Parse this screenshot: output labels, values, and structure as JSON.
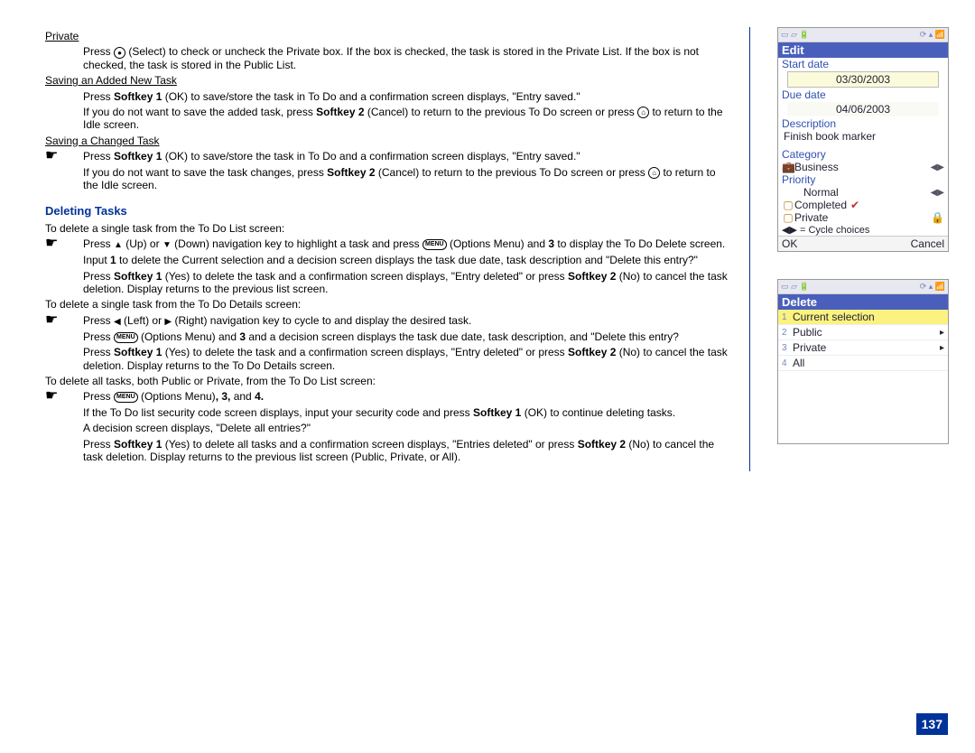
{
  "sections": {
    "private_hdr": "Private",
    "private_p1_a": "Press ",
    "private_p1_b": " (Select) to check or uncheck the Private box. If the box is checked, the task is stored in the Private List. If the box is not checked, the task is stored in the Public List.",
    "saving_add_hdr": "Saving an Added New Task",
    "saving_add_p1_a": "Press ",
    "saving_add_p1_b": "Softkey 1",
    "saving_add_p1_c": " (OK) to save/store the task in To Do and a confirmation screen displays, \"Entry saved.\"",
    "saving_add_p2_a": "If you do not want to save the added task, press ",
    "saving_add_p2_b": "Softkey 2",
    "saving_add_p2_c": " (Cancel) to return to the previous To Do screen or press ",
    "saving_add_p2_d": " to return to the Idle screen.",
    "saving_chg_hdr": "Saving a Changed Task",
    "saving_chg_b1_a": "Press ",
    "saving_chg_b1_b": "Softkey 1",
    "saving_chg_b1_c": " (OK) to save/store the task in To Do and a confirmation screen displays, \"Entry saved.\"",
    "saving_chg_p1_a": "If you do not want to save the task changes, press ",
    "saving_chg_p1_b": "Softkey 2",
    "saving_chg_p1_c": " (Cancel) to return to the previous To Do screen or press ",
    "saving_chg_p1_d": " to return to the Idle screen.",
    "deleting_title": "Deleting Tasks",
    "del_p1": "To delete a single task from the To Do List screen:",
    "del_b1_a": "Press ",
    "del_b1_b": " (Up) or ",
    "del_b1_c": " (Down) navigation key to highlight a task and press ",
    "del_b1_d": " (Options Menu) and ",
    "del_b1_e": "3",
    "del_b1_f": " to display the To Do Delete screen.",
    "del_p2_a": "Input ",
    "del_p2_b": "1",
    "del_p2_c": " to delete the Current selection and a decision screen displays the task due date, task description and \"Delete this entry?\"",
    "del_p3_a": "Press ",
    "del_p3_b": "Softkey 1",
    "del_p3_c": " (Yes) to delete the task and a confirmation screen displays, \"Entry deleted\" or press ",
    "del_p3_d": "Softkey 2",
    "del_p3_e": " (No) to cancel the task deletion. Display returns to the previous list screen.",
    "del_p4": "To delete a single task from the To Do Details screen:",
    "del_b2_a": "Press ",
    "del_b2_b": " (Left) or ",
    "del_b2_c": " (Right) navigation key to cycle to and display the desired task.",
    "del_p5_a": "Press ",
    "del_p5_b": " (Options Menu) and ",
    "del_p5_c": "3",
    "del_p5_d": " and a decision screen displays the task due date, task description, and \"Delete this entry?",
    "del_p6_a": "Press ",
    "del_p6_b": "Softkey 1",
    "del_p6_c": " (Yes) to delete the task and a confirmation screen displays, \"Entry deleted\" or press ",
    "del_p6_d": "Softkey 2",
    "del_p6_e": " (No) to cancel the task deletion. Display returns to the To Do Details screen.",
    "del_p7": "To delete all tasks, both Public or Private, from the To Do List screen:",
    "del_b3_a": "Press ",
    "del_b3_b": " (Options Menu)",
    "del_b3_c": ", 3, ",
    "del_b3_d": "and ",
    "del_b3_e": "4.",
    "del_p8_a": "If the To Do list security code screen displays, input your security code and press ",
    "del_p8_b": "Softkey 1",
    "del_p8_c": " (OK) to continue deleting tasks.",
    "del_p9": "A decision screen displays, \"Delete all entries?\"",
    "del_p10_a": "Press ",
    "del_p10_b": "Softkey 1",
    "del_p10_c": " (Yes) to delete all tasks and a confirmation screen displays, \"Entries deleted\" or press ",
    "del_p10_d": "Softkey 2",
    "del_p10_e": " (No) to cancel the task deletion. Display returns to the previous list screen (Public, Private, or All)."
  },
  "phone_edit": {
    "title": "Edit",
    "start_date_lbl": "Start date",
    "start_date_val": "03/30/2003",
    "due_date_lbl": "Due date",
    "due_date_val": "04/06/2003",
    "desc_lbl": "Description",
    "desc_val": "Finish book marker",
    "category_lbl": "Category",
    "category_val": "Business",
    "priority_lbl": "Priority",
    "priority_val": "Normal",
    "completed": "Completed",
    "private": "Private",
    "cycle": "= Cycle choices",
    "ok": "OK",
    "cancel": "Cancel"
  },
  "phone_delete": {
    "title": "Delete",
    "items": [
      "Current selection",
      "Public",
      "Private",
      "All"
    ]
  },
  "page_num": "137"
}
